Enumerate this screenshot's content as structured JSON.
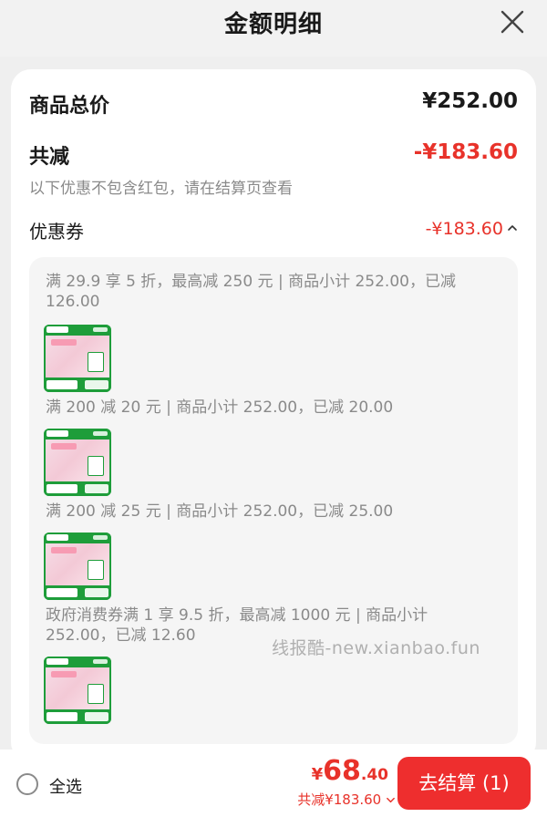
{
  "header": {
    "title": "金额明细",
    "close_icon": "close-icon"
  },
  "summary": {
    "total_label": "商品总价",
    "total_amount": "¥252.00",
    "reduce_label": "共减",
    "reduce_amount": "-¥183.60",
    "note": "以下优惠不包含红包，请在结算页查看",
    "coupon_label": "优惠券",
    "coupon_amount": "-¥183.60",
    "coupon_toggle_icon": "chevron-up-icon"
  },
  "coupons": [
    {
      "text": "满 29.9 享 5 折，最高减 250 元 | 商品小计 252.00，已减 126.00"
    },
    {
      "text": "满 200 减 20 元 | 商品小计 252.00，已减 20.00"
    },
    {
      "text": "满 200 减 25 元 | 商品小计 252.00，已减 25.00"
    },
    {
      "text": "政府消费券满 1 享 9.5 折，最高减 1000 元 | 商品小计 252.00，已减 12.60"
    }
  ],
  "watermark": "线报酷-new.xianbao.fun",
  "footer": {
    "select_all_label": "全选",
    "price_currency": "¥",
    "price_integer": "68",
    "price_decimal": ".40",
    "reduce_text": "共减¥183.60",
    "reduce_toggle_icon": "chevron-down-icon",
    "checkout_label": "去结算 (1)"
  },
  "colors": {
    "accent_red": "#e8322a",
    "checkout_red": "#ee2e2e",
    "product_green": "#1e9d3a"
  }
}
